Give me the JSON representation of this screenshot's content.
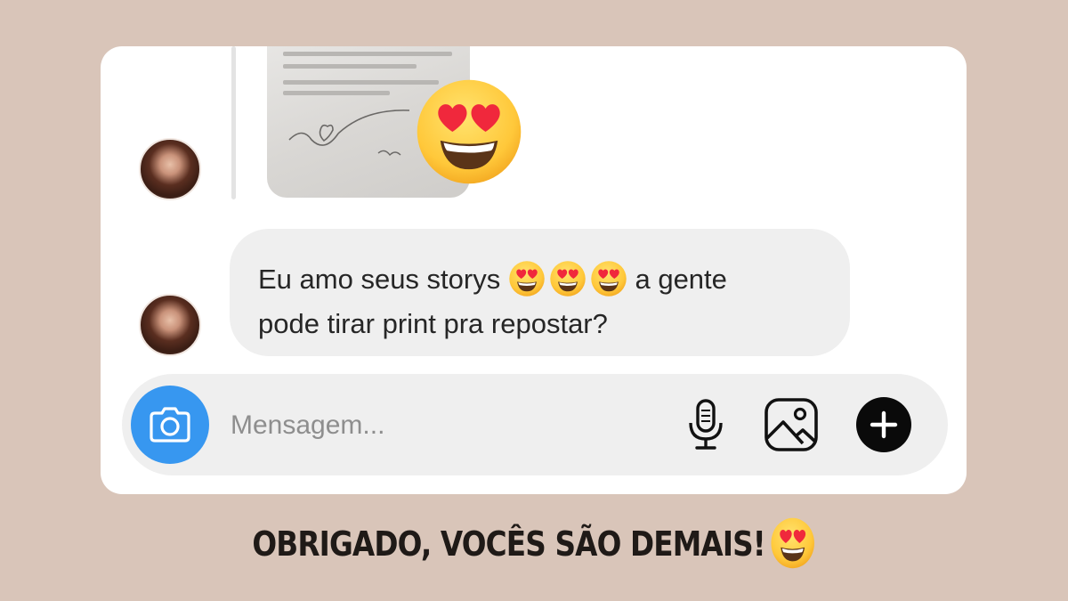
{
  "thread": {
    "message_text_line1": "Eu amo seus storys",
    "message_text_after_emojis": "a gente",
    "message_text_line2": "pode tirar print pra repostar?",
    "inline_emojis": [
      "heart-eyes-emoji",
      "heart-eyes-emoji",
      "heart-eyes-emoji"
    ],
    "story_reaction_emoji": "heart-eyes-emoji"
  },
  "composer": {
    "placeholder": "Mensagem...",
    "icons": [
      "camera-icon",
      "microphone-icon",
      "gallery-icon",
      "plus-icon"
    ]
  },
  "caption": {
    "text": "OBRIGADO, VOCÊS SÃO DEMAIS!",
    "emoji": "heart-eyes-emoji"
  },
  "colors": {
    "background": "#d9c5b9",
    "card": "#ffffff",
    "bubble": "#efefef",
    "camera_button": "#3797f0",
    "text": "#262626",
    "placeholder": "#8e8e8e"
  }
}
